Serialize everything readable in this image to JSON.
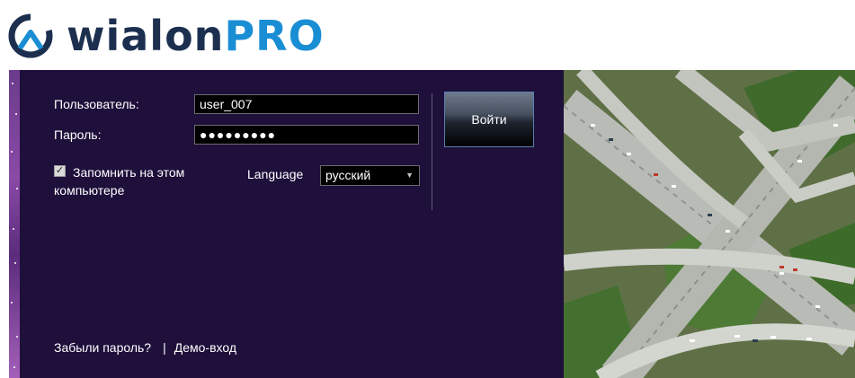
{
  "brand": {
    "name_main": "wialon",
    "name_suffix": "PRO",
    "colors": {
      "main": "#1c2f4f",
      "suffix": "#1a8ed4"
    }
  },
  "login": {
    "user_label": "Пользователь:",
    "user_value": "user_007",
    "password_label": "Пароль:",
    "password_value": "●●●●●●●●●",
    "remember_label": "Запомнить на этом компьютере",
    "remember_checked": true,
    "language_label": "Language",
    "language_selected": "русский",
    "submit_label": "Войти",
    "forgot_link": "Забыли пароль?",
    "separator": "|",
    "demo_link": "Демо-вход"
  },
  "theme": {
    "panel_bg": "#1e0f3b",
    "field_bg": "#000000"
  },
  "photo": {
    "subject": "highway-interchange-aerial"
  }
}
